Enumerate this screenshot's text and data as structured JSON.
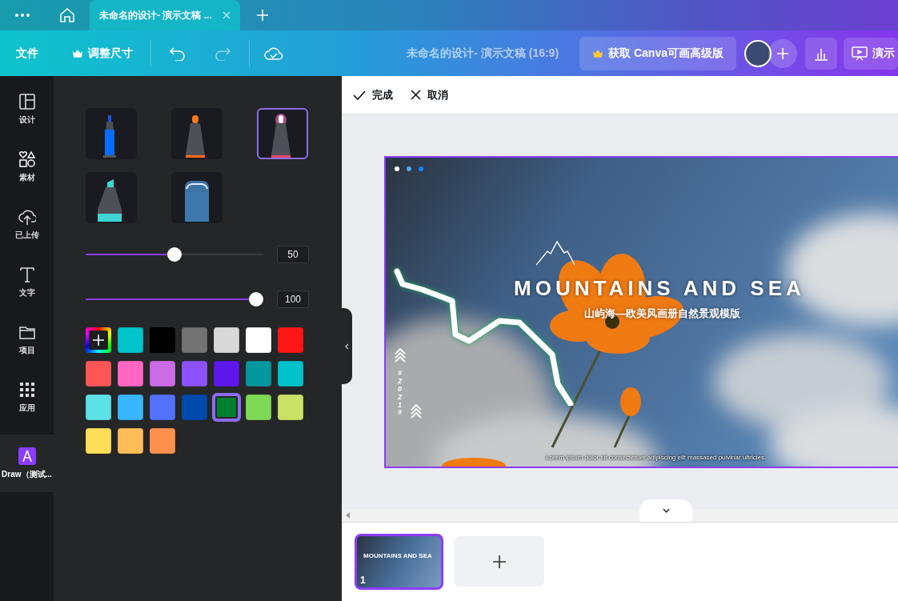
{
  "title_bar": {
    "tabs": [
      {
        "label": "未命名的设计- 演示文稿 ...",
        "selected": true
      }
    ]
  },
  "toolbar": {
    "file": "文件",
    "resize": "调整尺寸",
    "document_title": "未命名的设计- 演示文稿 (16:9)",
    "upgrade": "获取 Canva可画高级版",
    "present": "演示"
  },
  "sidebar": {
    "items": [
      {
        "kind": "design",
        "label": "设计",
        "selected": false
      },
      {
        "kind": "elements",
        "label": "素材",
        "selected": false
      },
      {
        "kind": "uploads",
        "label": "已上传",
        "selected": false
      },
      {
        "kind": "text",
        "label": "文字",
        "selected": false
      },
      {
        "kind": "projects",
        "label": "项目",
        "selected": false
      },
      {
        "kind": "apps",
        "label": "应用",
        "selected": false
      },
      {
        "kind": "draw",
        "label": "Draw（测试...",
        "selected": true
      }
    ]
  },
  "draw_panel": {
    "brushes": [
      {
        "kind": "pen",
        "selected": false
      },
      {
        "kind": "marker",
        "selected": false
      },
      {
        "kind": "glow",
        "selected": true
      },
      {
        "kind": "highlighter",
        "selected": false
      },
      {
        "kind": "eraser",
        "selected": false
      }
    ],
    "sliders": [
      {
        "level": 0.5,
        "reading": "50"
      },
      {
        "level": 1,
        "reading": "100"
      }
    ],
    "colors": [
      {
        "color": "#00c4cc",
        "selected": false
      },
      {
        "color": "#000000",
        "selected": false
      },
      {
        "color": "#737373",
        "selected": false
      },
      {
        "color": "#d9d9d9",
        "selected": false
      },
      {
        "color": "#ffffff",
        "selected": false
      },
      {
        "color": "#ff1616",
        "selected": false
      },
      {
        "color": "#ff5757",
        "selected": false
      },
      {
        "color": "#ff66c4",
        "selected": false
      },
      {
        "color": "#cb6ce6",
        "selected": false
      },
      {
        "color": "#8c52ff",
        "selected": false
      },
      {
        "color": "#5e17eb",
        "selected": false
      },
      {
        "color": "#03989e",
        "selected": false
      },
      {
        "color": "#00c2cb",
        "selected": false
      },
      {
        "color": "#5ce1e6",
        "selected": false
      },
      {
        "color": "#38b6ff",
        "selected": false
      },
      {
        "color": "#5271ff",
        "selected": false
      },
      {
        "color": "#004aad",
        "selected": false
      },
      {
        "color": "#00802f",
        "selected": true
      },
      {
        "color": "#7ed957",
        "selected": false
      },
      {
        "color": "#c9e265",
        "selected": false
      },
      {
        "color": "#ffde59",
        "selected": false
      },
      {
        "color": "#ffbd59",
        "selected": false
      },
      {
        "color": "#ff914d",
        "selected": false
      }
    ]
  },
  "edit_bar": {
    "done": "完成",
    "cancel": "取消"
  },
  "slide": {
    "title": "MOUNTAINS AND SEA",
    "subtitle": "山屿海—欧美风画册自然景观模版",
    "year": "#2021#",
    "footer": "Lorem ipsum dolor sit consectetuer adipiscing elit massased pulvinar ultricies."
  },
  "pages": [
    {
      "number": "1",
      "title": "MOUNTAINS AND SEA",
      "selected": true
    }
  ]
}
